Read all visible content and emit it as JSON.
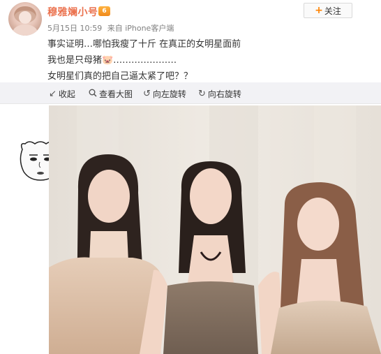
{
  "author": {
    "name": "穆雅斓小号",
    "badge": "6",
    "follow_label": "关注",
    "follow_icon": "plus-icon"
  },
  "meta": {
    "date_time": "5月15日 10:59",
    "source": "来自 iPhone客户端"
  },
  "post": {
    "line1": "事实证明…哪怕我瘦了十斤 在真正的女明星面前",
    "line2": "我也是只母猪🐷…………………",
    "line3": "女明星们真的把自己逼太紧了吧？？"
  },
  "toolbar": {
    "collapse_label": "收起",
    "view_large_label": "查看大图",
    "rotate_left_label": "向左旋转",
    "rotate_right_label": "向右旋转"
  },
  "colors": {
    "username": "#eb7350",
    "follow_plus": "#ff8200",
    "toolbar_bg": "#f2f2f5"
  }
}
